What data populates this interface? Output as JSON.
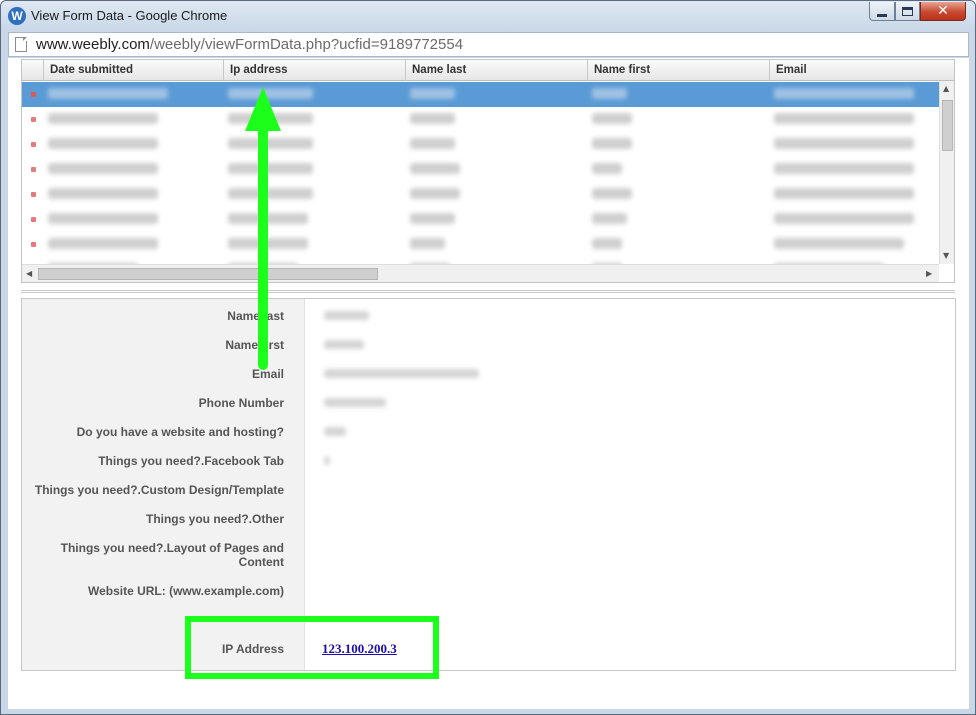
{
  "window": {
    "title": "View Form Data - Google Chrome",
    "logo_letter": "W",
    "close_glyph": "✕"
  },
  "address_bar": {
    "host": "www.weebly.com",
    "path": "/weebly/viewFormData.php?ucfid=9189772554"
  },
  "grid": {
    "columns": [
      "Date submitted",
      "Ip address",
      "Name last",
      "Name first",
      "Email"
    ],
    "selected_row": 0,
    "row_count_visible": 8
  },
  "details": {
    "fields": [
      {
        "label": "Name last",
        "has_value": true
      },
      {
        "label": "Name first",
        "has_value": true
      },
      {
        "label": "Email",
        "has_value": true
      },
      {
        "label": "Phone Number",
        "has_value": true
      },
      {
        "label": "Do you have a website and hosting?",
        "has_value": true
      },
      {
        "label": "Things you need?.Facebook Tab",
        "has_value": true
      },
      {
        "label": "Things you need?.Custom Design/Template",
        "has_value": false
      },
      {
        "label": "Things you need?.Other",
        "has_value": false
      },
      {
        "label": "Things you need?.Layout of Pages and Content",
        "has_value": false
      },
      {
        "label": "Website URL: (www.example.com)",
        "has_value": false
      }
    ],
    "ip_label": "IP Address",
    "ip_value": "123.100.200.3"
  },
  "annotation": {
    "color": "#1bff1b"
  },
  "icons": [
    "weebly-logo-icon",
    "minimize-icon",
    "maximize-icon",
    "close-icon",
    "page-icon",
    "up-arrow-icon",
    "down-arrow-icon",
    "left-arrow-icon",
    "right-arrow-icon"
  ]
}
